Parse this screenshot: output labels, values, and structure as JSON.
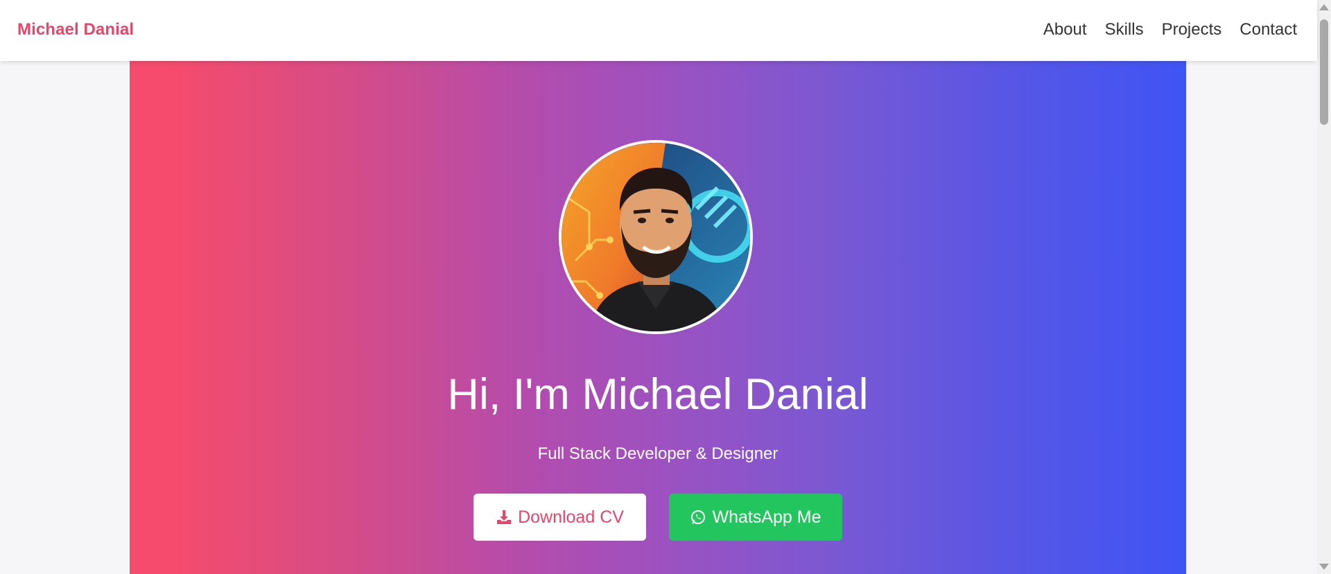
{
  "navbar": {
    "brand": "Michael Danial",
    "links": [
      "About",
      "Skills",
      "Projects",
      "Contact"
    ]
  },
  "hero": {
    "avatar_icon": "profile-avatar-illustration",
    "title": "Hi, I'm Michael Danial",
    "subtitle": "Full Stack Developer & Designer",
    "buttons": {
      "download_cv": {
        "label": "Download CV",
        "icon": "download-icon"
      },
      "whatsapp": {
        "label": "WhatsApp Me",
        "icon": "whatsapp-icon"
      }
    }
  },
  "colors": {
    "brand": "#e8456b",
    "gradient_start": "#f64b6c",
    "gradient_end": "#3f54f4",
    "whatsapp": "#22c55e"
  }
}
